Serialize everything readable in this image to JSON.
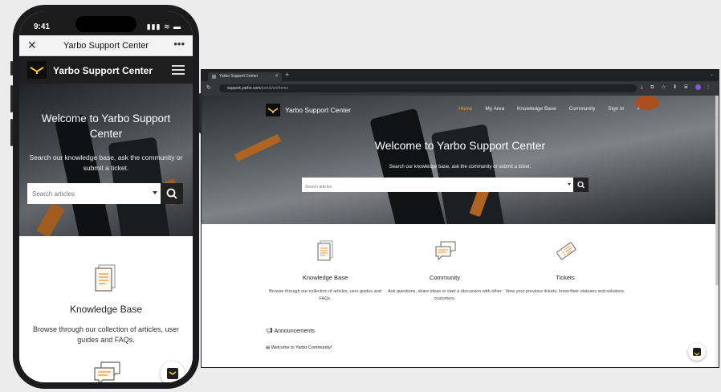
{
  "phone": {
    "status_time": "9:41",
    "status_icons": "▮▮▮ ≋ ▬",
    "browser_title": "Yarbo Support Center",
    "close_glyph": "✕",
    "more_glyph": "•••",
    "header_title": "Yarbo Support Center",
    "welcome": "Welcome to Yarbo Support Center",
    "subtitle": "Search our knowledge base, ask the community or submit a ticket.",
    "search_placeholder": "Search articles",
    "kb_title": "Knowledge Base",
    "kb_desc": "Browse through our collection of articles, user guides and FAQs."
  },
  "desktop": {
    "tab_title": "Yarbo Support Center",
    "tab_close": "✕",
    "new_tab": "+",
    "url_host": "support.yarbo.com",
    "url_path": "/portal/en/home",
    "brand": "Yarbo Support Center",
    "nav": [
      "Home",
      "My Area",
      "Knowledge Base",
      "Community",
      "Sign In"
    ],
    "welcome": "Welcome to Yarbo Support Center",
    "subtitle": "Search our knowledge base, ask the community or submit a ticket.",
    "search_placeholder": "Search articles",
    "cards": [
      {
        "title": "Knowledge Base",
        "desc": "Browse through our collection of articles, user guides and FAQs."
      },
      {
        "title": "Community",
        "desc": "Ask questions, share ideas or start a discussion with other customers."
      },
      {
        "title": "Tickets",
        "desc": "View your previous tickets; know their statuses and solutions."
      }
    ],
    "announcements_title": "Announcements",
    "announcement_item": "Welcome to Yarbo Community!"
  },
  "colors": {
    "accent": "#f0a24a",
    "dark": "#1e1e1e",
    "logo_yellow": "#f5c842"
  },
  "icons": [
    "close-icon",
    "more-icon",
    "hamburger-menu-icon",
    "search-icon",
    "document-icon",
    "chat-bubbles-icon",
    "ticket-icon",
    "megaphone-icon",
    "reload-icon",
    "yarbo-logo"
  ]
}
